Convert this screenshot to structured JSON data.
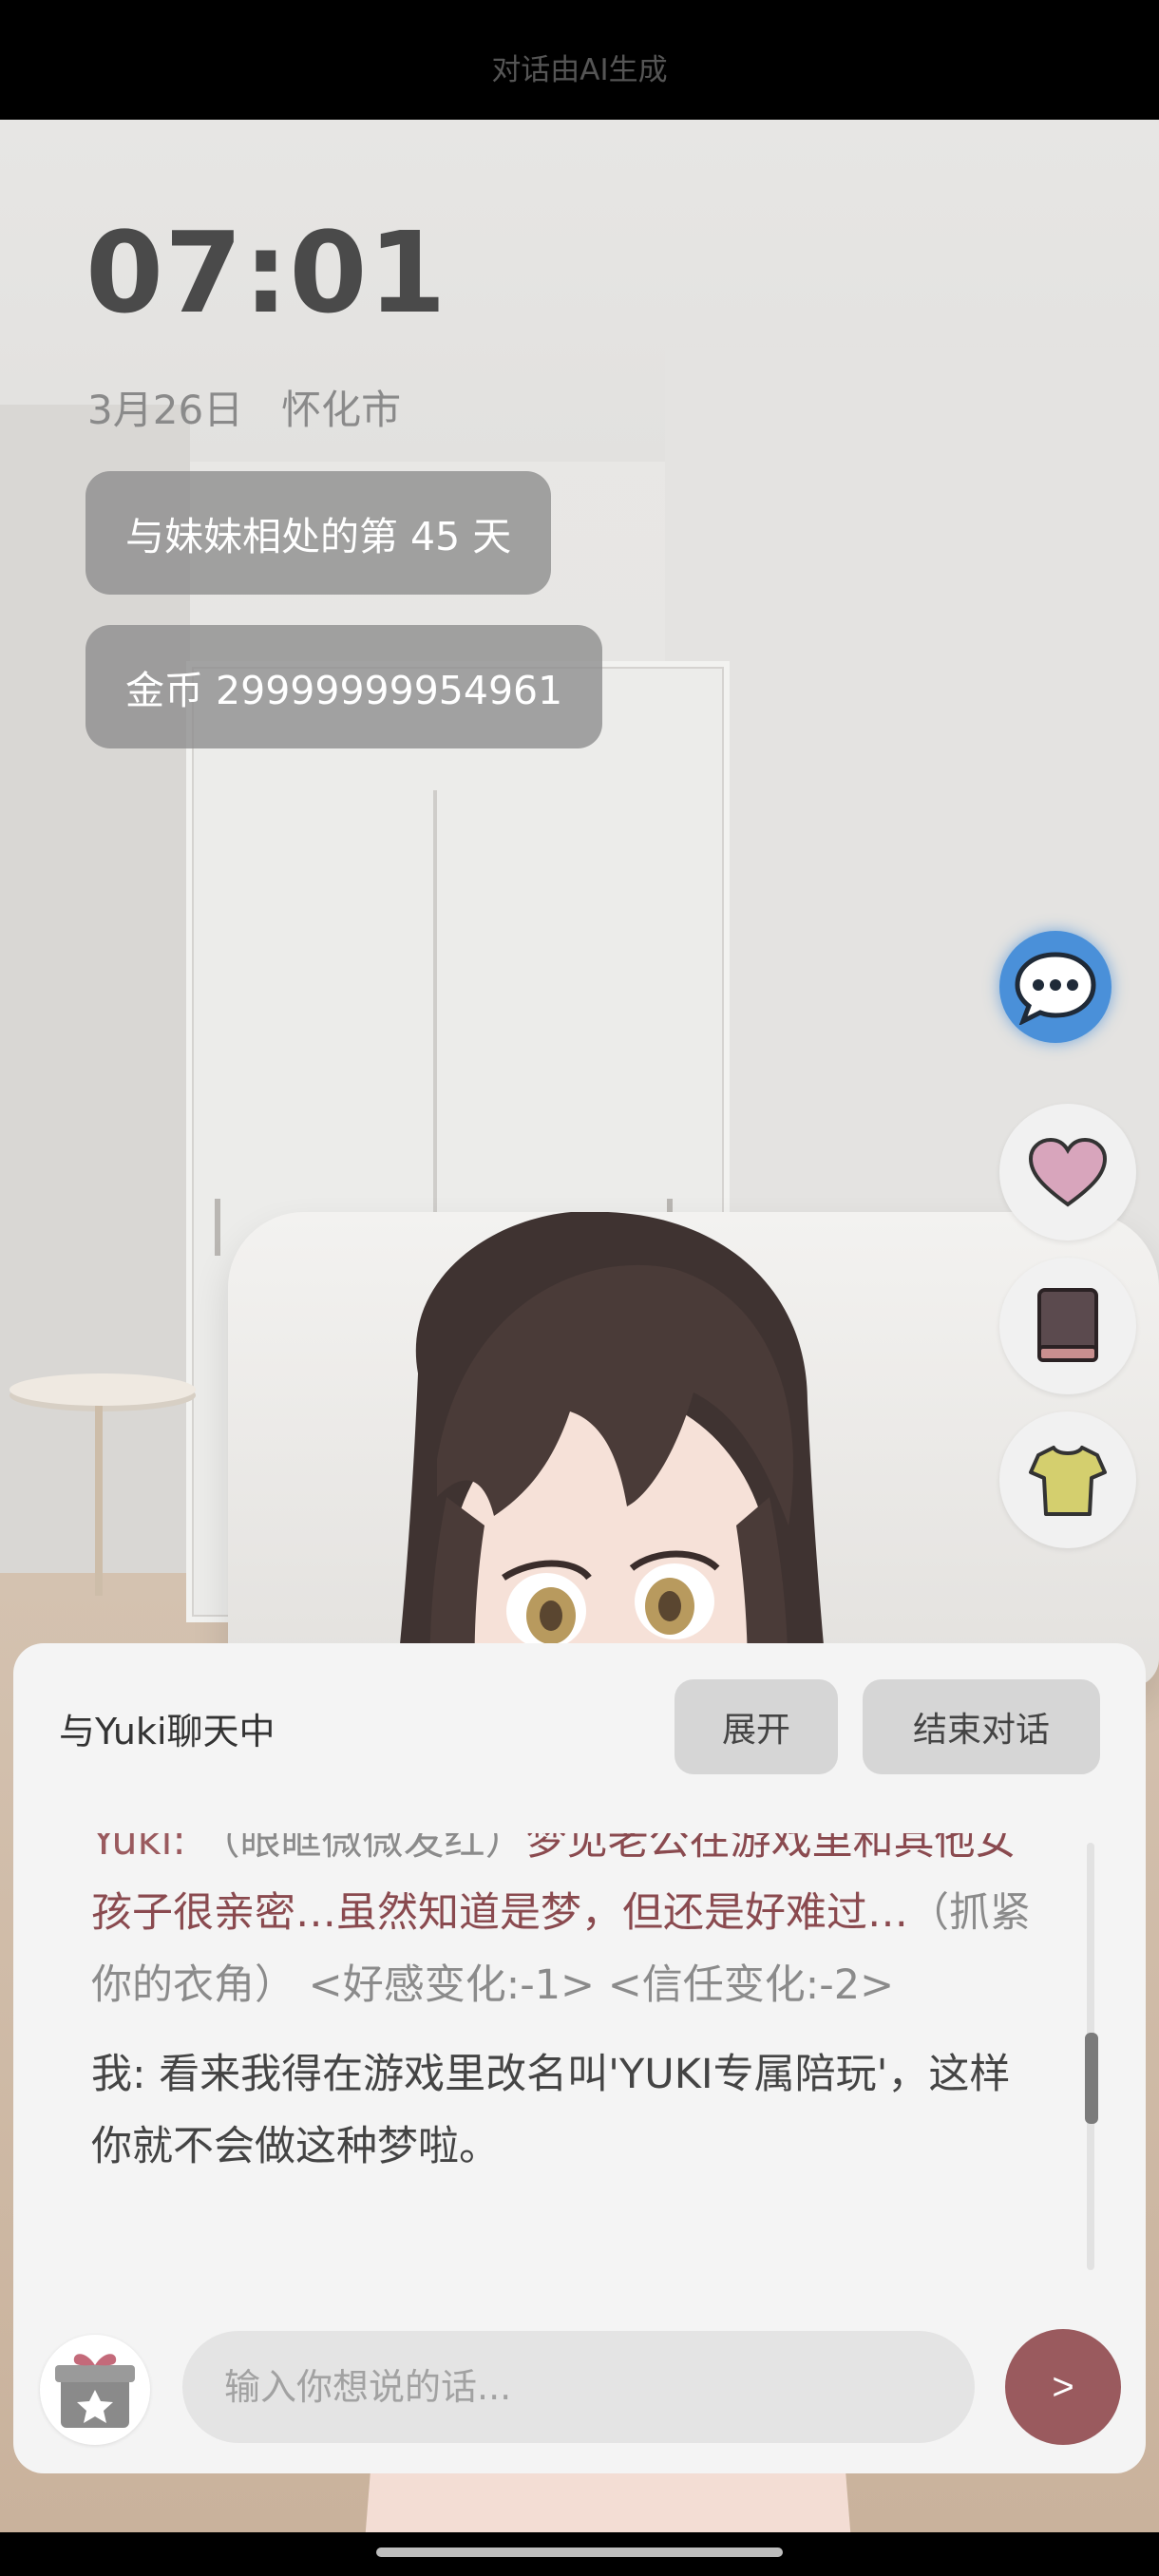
{
  "hud": {
    "ai_note": "对话由AI生成",
    "time": "07:01",
    "date": "3月26日",
    "city": "怀化市",
    "days_badge": "与妹妹相处的第 45 天",
    "coins_badge": "金币 29999999954961"
  },
  "side_buttons": [
    {
      "name": "chat-icon",
      "color": "#4a90d9"
    },
    {
      "name": "heart-icon",
      "color": "#d8a5bc"
    },
    {
      "name": "book-icon",
      "color": "#5b4a4e"
    },
    {
      "name": "shirt-icon",
      "color": "#d4cf6e"
    }
  ],
  "chat_panel": {
    "title": "与Yuki聊天中",
    "expand_label": "展开",
    "end_label": "结束对话",
    "messages": [
      {
        "speaker": "Yuki:",
        "emotion": "（眼眶微微发红）",
        "text": "梦见老公在游戏里和其他女孩子很亲密…虽然知道是梦，但还是好难过…",
        "action": "（抓紧你的衣角）",
        "status": "<好感变化:-1> <信任变化:-2>"
      },
      {
        "speaker": "我:",
        "text": "看来我得在游戏里改名叫'YUKI专属陪玩'，这样你就不会做这种梦啦。"
      }
    ],
    "input_placeholder": "输入你想说的话...",
    "send_label": ">"
  },
  "colors": {
    "accent": "#9a5a5e",
    "chat_fab": "#4a90d9"
  }
}
